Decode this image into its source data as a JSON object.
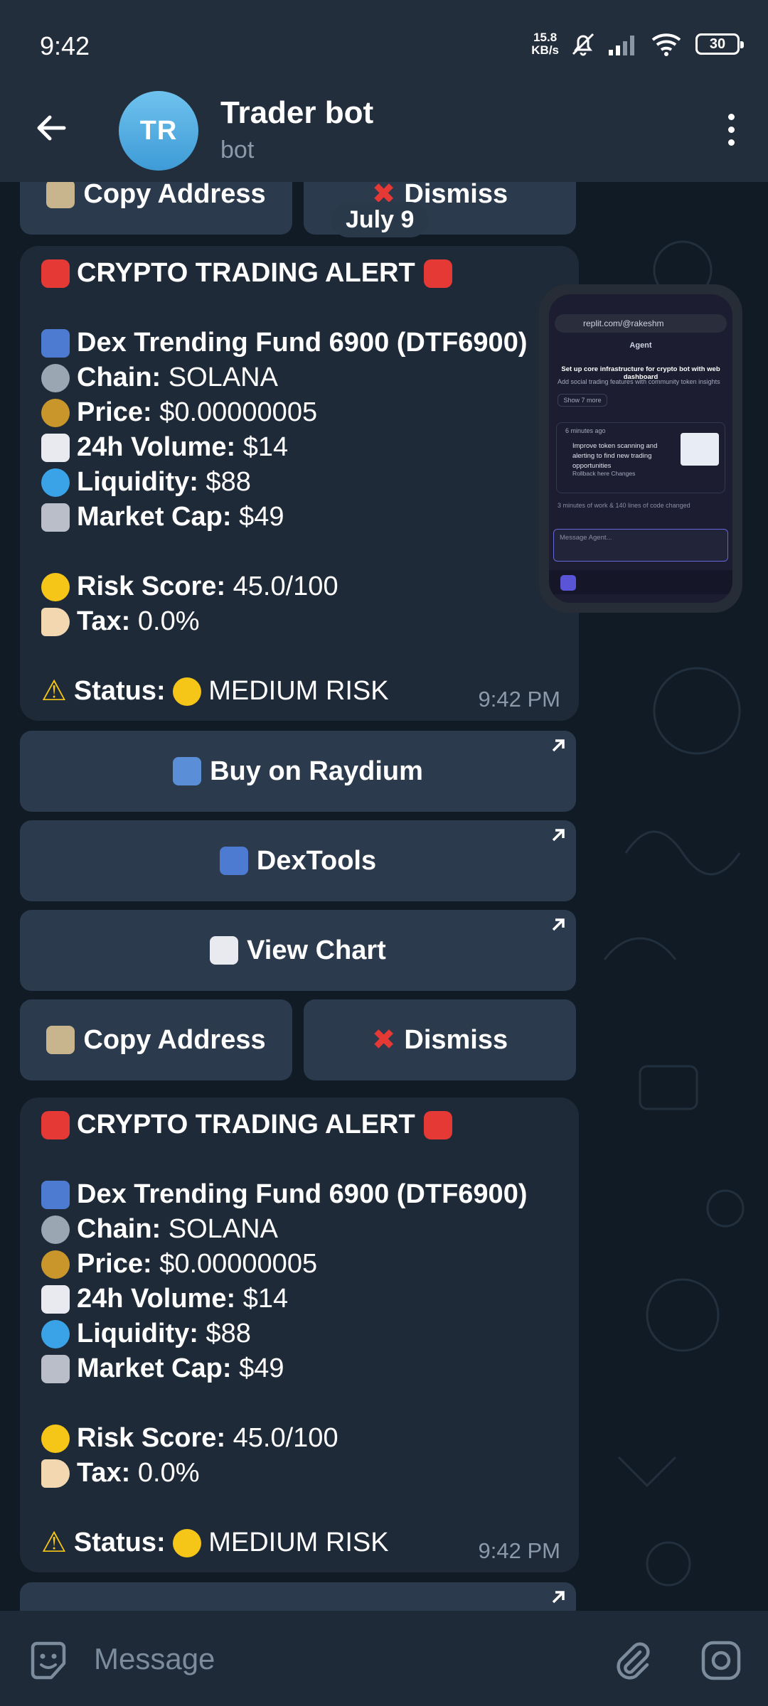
{
  "status_bar": {
    "time": "9:42",
    "net_speed_value": "15.8",
    "net_speed_unit": "KB/s",
    "battery": "30"
  },
  "header": {
    "avatar_initials": "TR",
    "title": "Trader bot",
    "subtitle": "bot"
  },
  "top_keyboard": {
    "copy_label": "Copy Address",
    "dismiss_label": "Dismiss"
  },
  "date_divider": "July 9",
  "alerts": [
    {
      "title": "CRYPTO TRADING ALERT",
      "token": "Dex Trending Fund 6900 (DTF6900)",
      "chain_label": "Chain:",
      "chain_value": "SOLANA",
      "price_label": "Price:",
      "price_value": "$0.00000005",
      "volume_label": "24h Volume:",
      "volume_value": "$14",
      "liquidity_label": "Liquidity:",
      "liquidity_value": "$88",
      "mcap_label": "Market Cap:",
      "mcap_value": "$49",
      "risk_label": "Risk Score:",
      "risk_value": "45.0/100",
      "tax_label": "Tax:",
      "tax_value": "0.0%",
      "status_label": "Status:",
      "status_value": "MEDIUM RISK",
      "time": "9:42 PM"
    },
    {
      "title": "CRYPTO TRADING ALERT",
      "token": "Dex Trending Fund 6900 (DTF6900)",
      "chain_label": "Chain:",
      "chain_value": "SOLANA",
      "price_label": "Price:",
      "price_value": "$0.00000005",
      "volume_label": "24h Volume:",
      "volume_value": "$14",
      "liquidity_label": "Liquidity:",
      "liquidity_value": "$88",
      "mcap_label": "Market Cap:",
      "mcap_value": "$49",
      "risk_label": "Risk Score:",
      "risk_value": "45.0/100",
      "tax_label": "Tax:",
      "tax_value": "0.0%",
      "status_label": "Status:",
      "status_value": "MEDIUM RISK",
      "time": "9:42 PM"
    }
  ],
  "keyboard": {
    "buy_label": "Buy on Raydium",
    "dextools_label": "DexTools",
    "chart_label": "View Chart",
    "copy_label": "Copy Address",
    "dismiss_label": "Dismiss"
  },
  "pip": {
    "url": "replit.com/@rakeshm",
    "agent_label": "Agent",
    "heading": "Set up core infrastructure for crypto bot with web dashboard",
    "subline": "Add social trading features with community token insights",
    "show_more": "Show 7 more",
    "card_time": "6 minutes ago",
    "card_text": "Improve token scanning and alerting to find new trading opportunities",
    "card_actions": "Rollback here   Changes",
    "changes_line": "3 minutes of work & 140 lines of code changed",
    "input_placeholder": "Message Agent..."
  },
  "composer": {
    "placeholder": "Message"
  },
  "colors": {
    "header_bg": "#232e3c",
    "bubble_bg": "#1e2a37",
    "button_bg": "#2b3a4c",
    "muted_text": "#8b9aa9",
    "avatar": "#4aa6de"
  }
}
